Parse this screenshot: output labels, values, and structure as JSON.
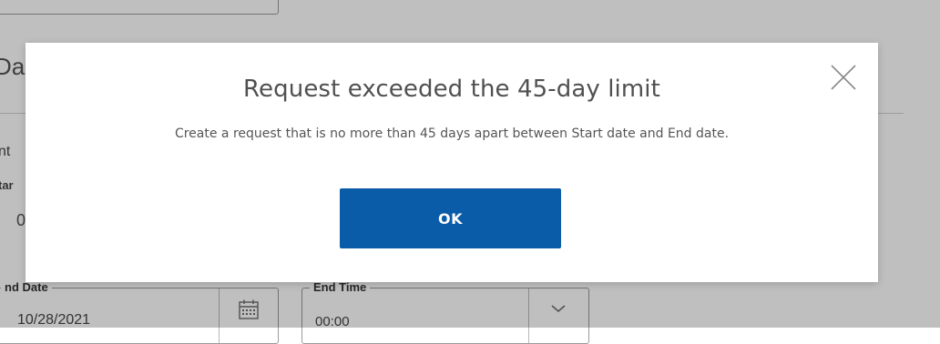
{
  "background": {
    "section_title_fragment": "Da",
    "label_fragment_a": "nt",
    "label_fragment_b": "tar",
    "value_fragment_c": "0",
    "end_date": {
      "label": "nd Date",
      "value": "10/28/2021",
      "icon": "calendar-icon"
    },
    "end_time": {
      "label": "End Time",
      "value": "00:00",
      "icon": "chevron-down-icon"
    }
  },
  "modal": {
    "title": "Request exceeded the 45-day limit",
    "message": "Create a request that is no more than 45 days apart between Start date and End date.",
    "ok_label": "OK",
    "close_icon": "close-icon"
  },
  "colors": {
    "primary_button": "#0a5ba8",
    "overlay": "rgba(0,0,0,0.25)",
    "title_text": "#505050",
    "body_text": "#555555"
  }
}
